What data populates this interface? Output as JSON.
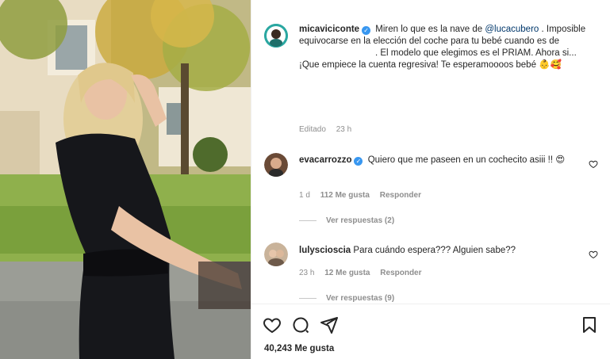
{
  "post": {
    "author": "micaviciconte",
    "caption_a": "Miren lo que es la nave de ",
    "mention": "@lucacubero",
    "caption_b": " . Imposible equivocarse en la elección del coche para tu bebé cuando es de",
    "caption_c": ". El modelo que elegimos es el PRIAM. Ahora si... ¡Que empiece la cuenta regresiva! Te esperamoooos bebé 👶🥰",
    "edited_label": "Editado",
    "time": "23 h"
  },
  "comments": [
    {
      "username": "evacarrozzo",
      "verified": true,
      "text": "Quiero que me paseen en un cochecito asiii !! 😍",
      "time": "1 d",
      "likes": "112 Me gusta",
      "reply_label": "Responder",
      "view_replies": "Ver respuestas (2)"
    },
    {
      "username": "lulyscioscia",
      "verified": false,
      "text": "Para cuándo espera??? Alguien sabe??",
      "time": "23 h",
      "likes": "12 Me gusta",
      "reply_label": "Responder",
      "view_replies": "Ver respuestas (9)"
    }
  ],
  "footer": {
    "likes_count": "40,243 Me gusta"
  },
  "icons": {
    "like": "heart-icon",
    "comment": "comment-icon",
    "share": "share-icon",
    "save": "bookmark-icon",
    "comment_like": "heart-icon"
  },
  "colors": {
    "verified": "#3897f0",
    "mention": "#00376b",
    "muted": "#8e8e8e"
  }
}
